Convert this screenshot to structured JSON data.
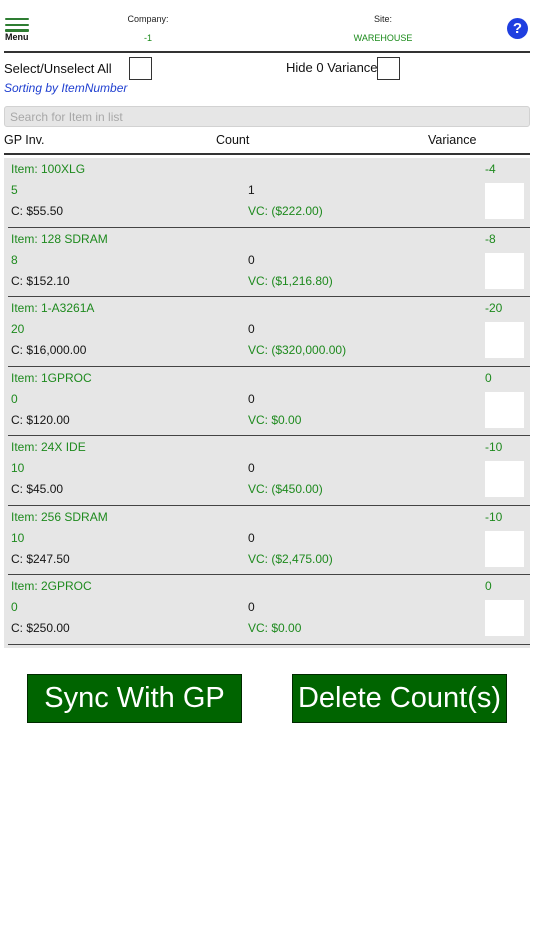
{
  "header": {
    "menu_label": "Menu",
    "company_label": "Company:",
    "company_value": "-1",
    "site_label": "Site:",
    "site_value": "WAREHOUSE",
    "help_glyph": "?"
  },
  "options": {
    "select_all_label": "Select/Unselect All",
    "hide_zero_label": "Hide 0 Variances",
    "sorting_text": "Sorting by ItemNumber"
  },
  "search": {
    "placeholder": "Search for Item in list",
    "value": ""
  },
  "columns": {
    "gp_inv": "GP Inv.",
    "count": "Count",
    "variance": "Variance"
  },
  "items": [
    {
      "item": "Item: 100XLG",
      "gp_inv": "5",
      "count": "1",
      "cost": "C: $55.50",
      "variance": "-4",
      "variance_cost": "VC: ($222.00)"
    },
    {
      "item": "Item: 128 SDRAM",
      "gp_inv": "8",
      "count": "0",
      "cost": "C: $152.10",
      "variance": "-8",
      "variance_cost": "VC: ($1,216.80)"
    },
    {
      "item": "Item: 1-A3261A",
      "gp_inv": "20",
      "count": "0",
      "cost": "C: $16,000.00",
      "variance": "-20",
      "variance_cost": "VC: ($320,000.00)"
    },
    {
      "item": "Item: 1GPROC",
      "gp_inv": "0",
      "count": "0",
      "cost": "C: $120.00",
      "variance": "0",
      "variance_cost": "VC: $0.00"
    },
    {
      "item": "Item: 24X IDE",
      "gp_inv": "10",
      "count": "0",
      "cost": "C: $45.00",
      "variance": "-10",
      "variance_cost": "VC: ($450.00)"
    },
    {
      "item": "Item: 256 SDRAM",
      "gp_inv": "10",
      "count": "0",
      "cost": "C: $247.50",
      "variance": "-10",
      "variance_cost": "VC: ($2,475.00)"
    },
    {
      "item": "Item: 2GPROC",
      "gp_inv": "0",
      "count": "0",
      "cost": "C: $250.00",
      "variance": "0",
      "variance_cost": "VC: $0.00"
    }
  ],
  "buttons": {
    "sync": "Sync With GP",
    "delete": "Delete Count(s)"
  },
  "colors": {
    "accent_green": "#1e8a1e",
    "button_green": "#006400",
    "help_blue": "#1f3fe0",
    "sorting_blue": "#1f3fd0",
    "list_bg": "#e6e6e6"
  }
}
